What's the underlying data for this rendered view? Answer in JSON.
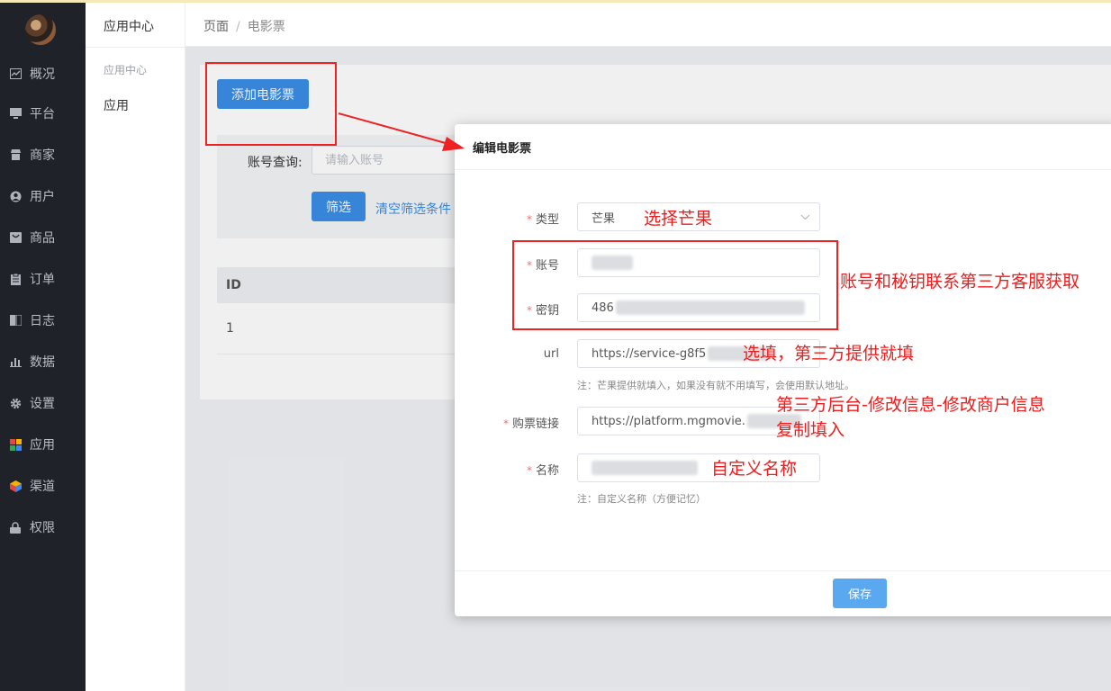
{
  "sidebar": {
    "items": [
      {
        "label": "概况",
        "icon": "chart-icon"
      },
      {
        "label": "平台",
        "icon": "monitor-icon"
      },
      {
        "label": "商家",
        "icon": "store-icon"
      },
      {
        "label": "用户",
        "icon": "user-icon"
      },
      {
        "label": "商品",
        "icon": "product-icon"
      },
      {
        "label": "订单",
        "icon": "clipboard-icon"
      },
      {
        "label": "日志",
        "icon": "book-icon"
      },
      {
        "label": "数据",
        "icon": "bar-chart-icon"
      },
      {
        "label": "设置",
        "icon": "gear-icon"
      },
      {
        "label": "应用",
        "icon": "apps-icon"
      },
      {
        "label": "渠道",
        "icon": "cube-icon"
      },
      {
        "label": "权限",
        "icon": "lock-icon"
      }
    ]
  },
  "submenu": {
    "title": "应用中心",
    "group": "应用中心",
    "item": "应用"
  },
  "breadcrumb": {
    "root": "页面",
    "separator": "/",
    "current": "电影票"
  },
  "page": {
    "add_button": "添加电影票",
    "account_label": "账号查询:",
    "account_placeholder": "请输入账号",
    "filter_button": "筛选",
    "clear_link": "清空筛选条件",
    "table": {
      "columns": [
        "ID"
      ],
      "rows": [
        [
          "1"
        ]
      ]
    }
  },
  "modal": {
    "title": "编辑电影票",
    "fields": {
      "type": {
        "label": "类型",
        "value": "芒果"
      },
      "account": {
        "label": "账号"
      },
      "secret": {
        "label": "密钥",
        "value_prefix": "486"
      },
      "url": {
        "label": "url",
        "value": "https://service-g8f5",
        "hint": "注：芒果提供就填入，如果没有就不用填写，会使用默认地址。"
      },
      "purchase_link": {
        "label": "购票链接",
        "value": "https://platform.mgmovie."
      },
      "name": {
        "label": "名称",
        "hint": "注：自定义名称（方便记忆）"
      }
    },
    "save_button": "保存"
  },
  "annotations": {
    "choose_mango": "选择芒果",
    "account_secret": "账号和秘钥联系第三方客服获取",
    "optional": "选填，第三方提供就填",
    "backend_line1": "第三方后台-修改信息-修改商户信息",
    "backend_line2": "复制填入",
    "custom_name": "自定义名称",
    "color": "#ee1c1c"
  },
  "colors": {
    "primary": "#3a8ee6",
    "sidebar": "#20222a",
    "required": "#f56c6c"
  }
}
